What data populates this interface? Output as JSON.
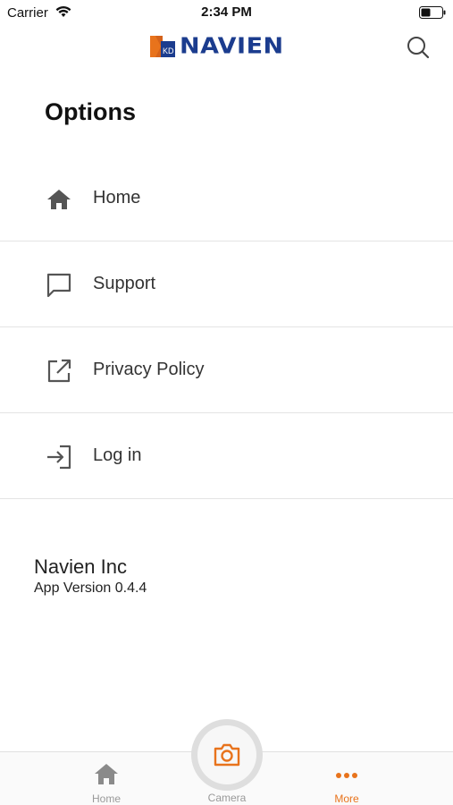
{
  "status_bar": {
    "carrier": "Carrier",
    "time": "2:34 PM"
  },
  "header": {
    "logo_text": "NAVIEN",
    "logo_badge": "KD",
    "brand_color": "#1b3c8e",
    "logo_accent_color": "#e8731c",
    "search_icon": "search-icon"
  },
  "page": {
    "title": "Options"
  },
  "menu": {
    "items": [
      {
        "label": "Home",
        "icon": "home-icon"
      },
      {
        "label": "Support",
        "icon": "chat-bubble-icon"
      },
      {
        "label": "Privacy Policy",
        "icon": "external-link-icon"
      },
      {
        "label": "Log in",
        "icon": "login-icon"
      }
    ]
  },
  "footer_info": {
    "company": "Navien Inc",
    "version": "App Version 0.4.4"
  },
  "tab_bar": {
    "accent_color": "#e8731c",
    "inactive_color": "#999999",
    "tabs": [
      {
        "label": "Home",
        "icon": "home-icon",
        "active": false
      },
      {
        "label": "Camera",
        "icon": "camera-icon",
        "active": false
      },
      {
        "label": "More",
        "icon": "more-dots-icon",
        "active": true
      }
    ]
  }
}
